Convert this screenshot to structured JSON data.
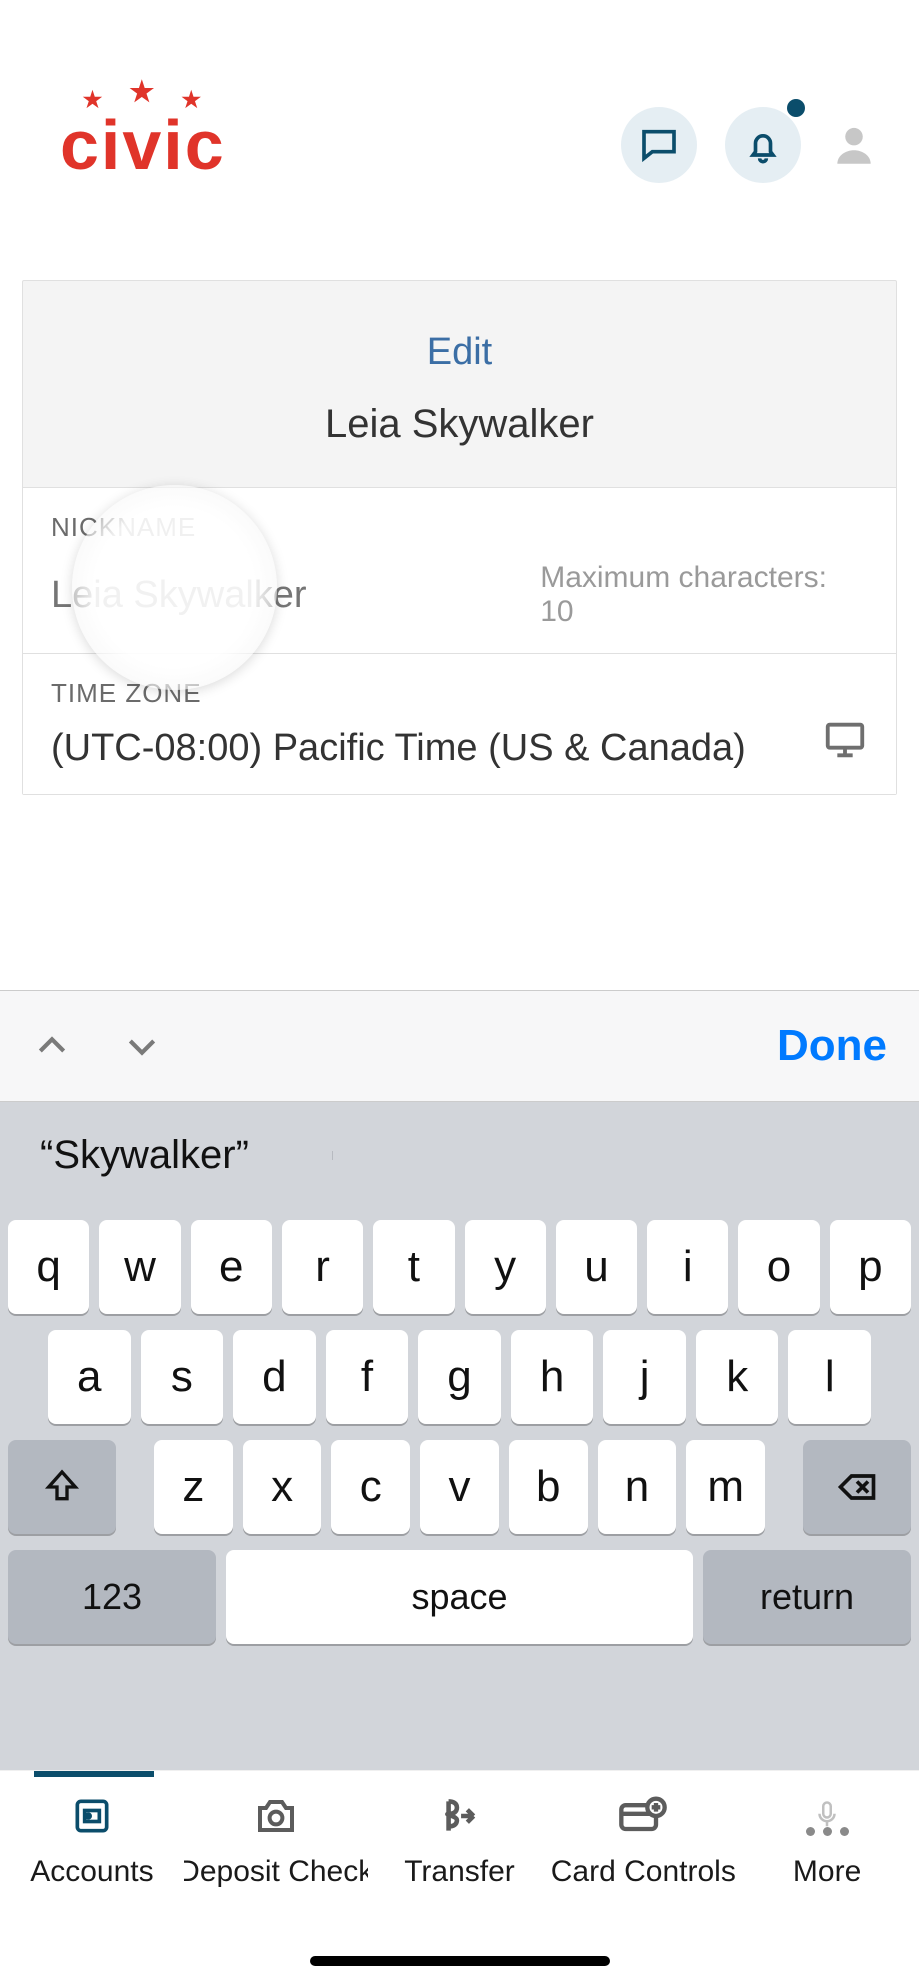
{
  "header": {
    "logo_text": "civic"
  },
  "edit": {
    "link": "Edit",
    "name": "Leia Skywalker"
  },
  "nickname": {
    "label": "NICKNAME",
    "placeholder": "Leia Skywalker",
    "hint": "Maximum characters: 10"
  },
  "timezone": {
    "label": "TIME ZONE",
    "value": "(UTC-08:00) Pacific Time (US & Canada)"
  },
  "accessory": {
    "done": "Done"
  },
  "suggest": {
    "s1": "“Skywalker”",
    "s2": "",
    "s3": ""
  },
  "keys": {
    "r1": [
      "q",
      "w",
      "e",
      "r",
      "t",
      "y",
      "u",
      "i",
      "o",
      "p"
    ],
    "r2": [
      "a",
      "s",
      "d",
      "f",
      "g",
      "h",
      "j",
      "k",
      "l"
    ],
    "r3": [
      "z",
      "x",
      "c",
      "v",
      "b",
      "n",
      "m"
    ],
    "k123": "123",
    "space": "space",
    "return": "return"
  },
  "tabs": {
    "t1": "Accounts",
    "t2": "Deposit Check",
    "t3": "Transfer",
    "t4": "Card Controls",
    "t5": "More"
  }
}
